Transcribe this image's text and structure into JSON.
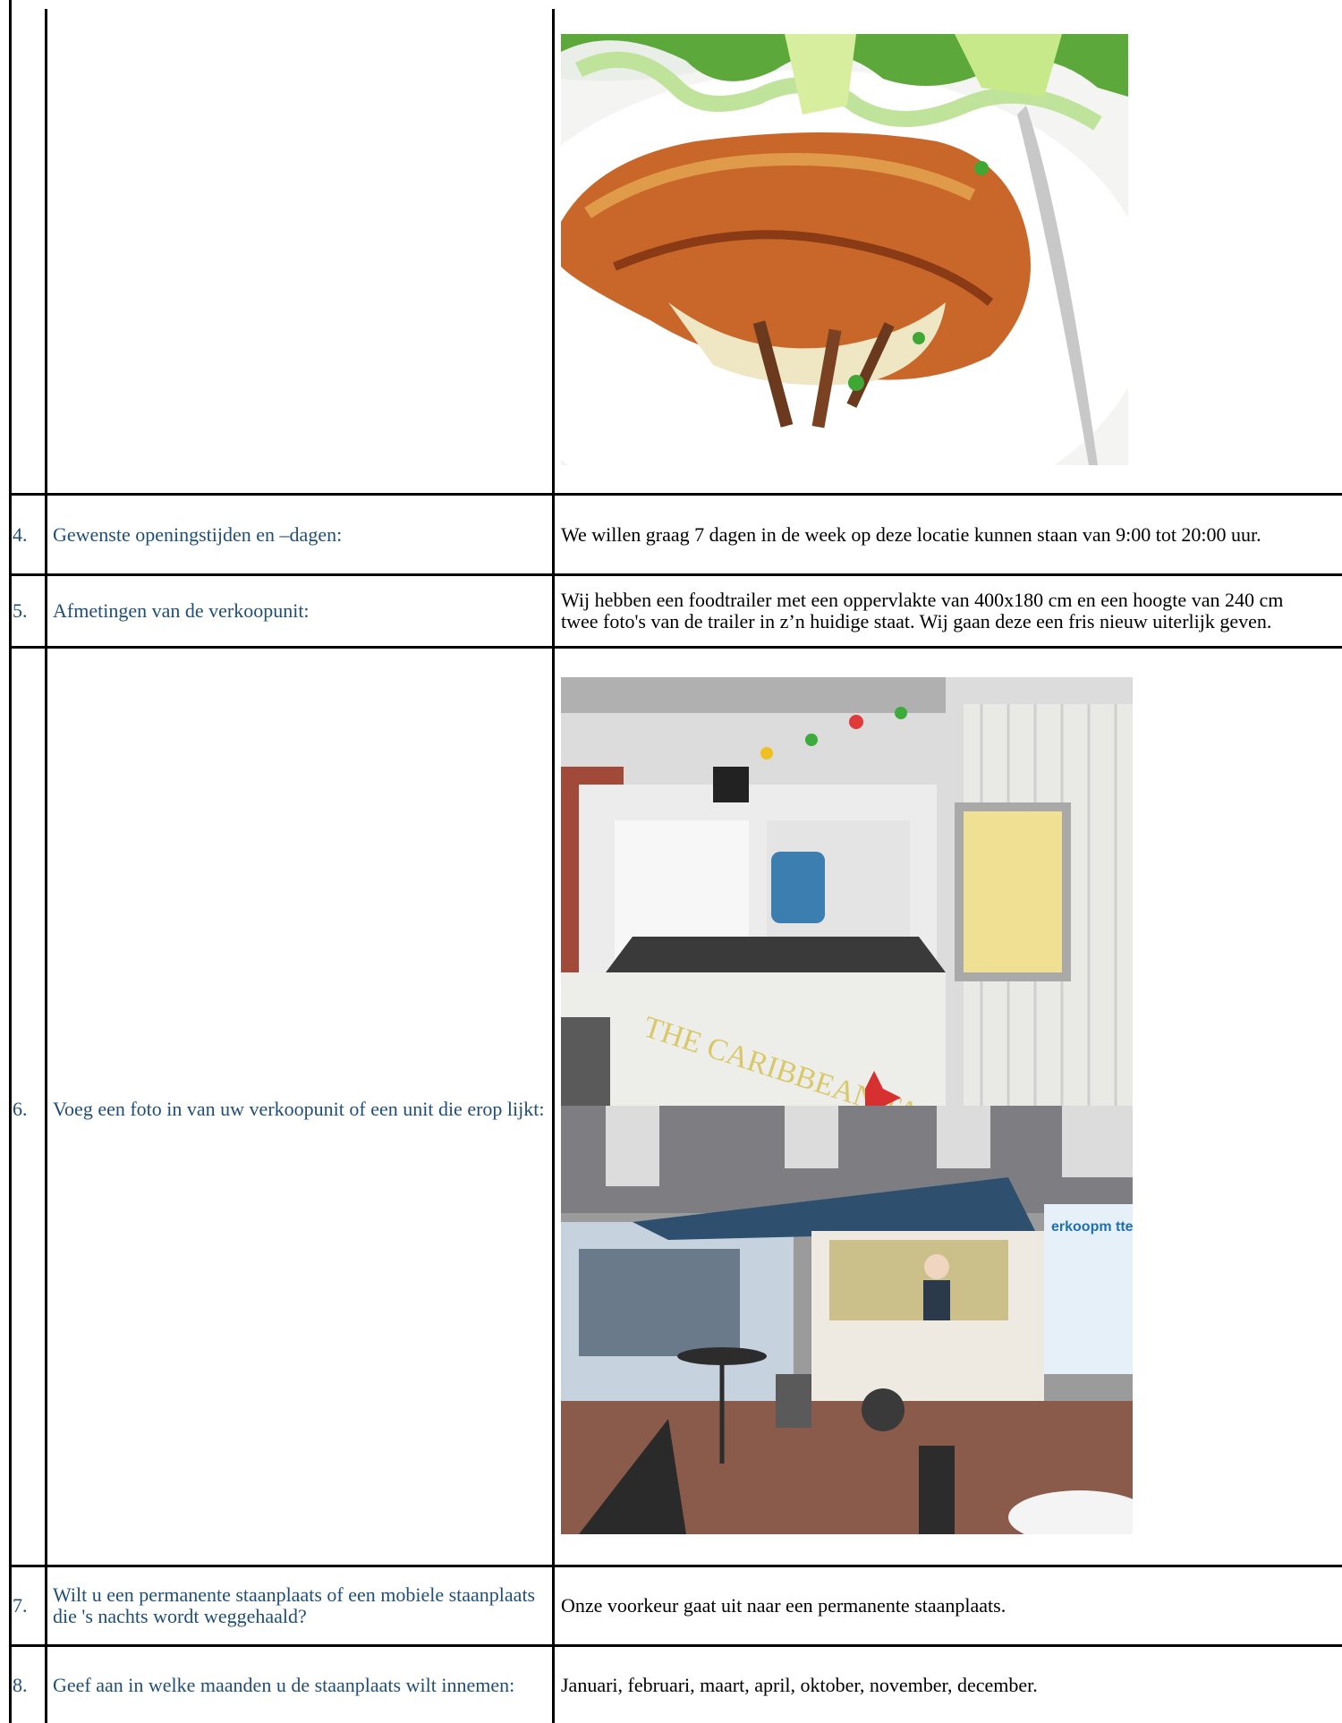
{
  "rows": [
    {
      "number": "4.",
      "question": "Gewenste openingstijden en –dagen:",
      "answer": "We willen graag 7 dagen in de week op deze locatie kunnen staan van 9:00 tot 20:00 uur."
    },
    {
      "number": "5.",
      "question": "Afmetingen van de verkoopunit:",
      "answer_line1": "Wij hebben een foodtrailer met een oppervlakte van 400x180 cm en een hoogte van 240 cm",
      "answer_line2": "twee foto's van de trailer in z’n huidige staat. Wij gaan deze een fris nieuw uiterlijk geven."
    },
    {
      "number": "6.",
      "question": "Voeg een foto in van uw verkoopunit of een unit die erop lijkt:"
    },
    {
      "number": "7.",
      "question": "Wilt u een permanente staanplaats of een mobiele staanplaats die 's nachts wordt weggehaald?",
      "answer": "Onze voorkeur gaat uit naar een permanente staanplaats."
    },
    {
      "number": "8.",
      "question": "Geef aan in welke maanden u de staanplaats wilt innemen:",
      "answer": "Januari, februari, maart, april, oktober, november, december."
    }
  ],
  "photos": {
    "food": {
      "icon": "omelette-photo"
    },
    "trailer_interior": {
      "icon": "trailer-interior-photo",
      "sign_text": "THE CARIBBEAN TASTE"
    },
    "trailer_exterior": {
      "icon": "trailer-exterior-photo",
      "shop_sign": "erkoopm ttewonin"
    }
  },
  "colors": {
    "question_text": "#1f4e79",
    "border": "#000000"
  }
}
